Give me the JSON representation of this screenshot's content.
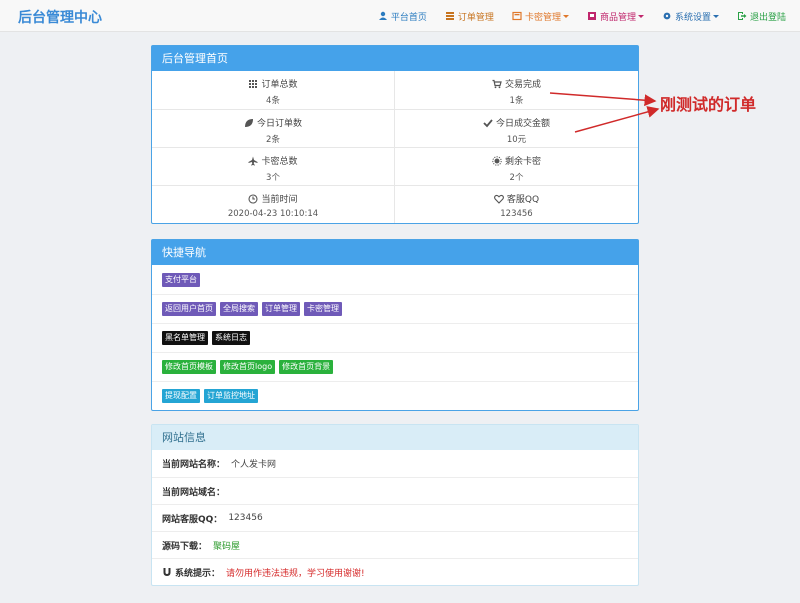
{
  "header": {
    "title": "后台管理中心",
    "nav": [
      {
        "label": "平台首页",
        "icon": "user-icon",
        "color": "#2a7bbf",
        "caret": false
      },
      {
        "label": "订单管理",
        "icon": "list-icon",
        "color": "#c7741f",
        "caret": false
      },
      {
        "label": "卡密管理",
        "icon": "card-icon",
        "color": "#e0782b",
        "caret": true
      },
      {
        "label": "商品管理",
        "icon": "shop-icon",
        "color": "#c0266c",
        "caret": true
      },
      {
        "label": "系统设置",
        "icon": "gear-icon",
        "color": "#2a6fb0",
        "caret": true
      },
      {
        "label": "退出登陆",
        "icon": "exit-icon",
        "color": "#29a045",
        "caret": false
      }
    ]
  },
  "home_panel": {
    "title": "后台管理首页",
    "stats": [
      {
        "label": "订单总数",
        "icon": "grid-icon",
        "value": "4条"
      },
      {
        "label": "交易完成",
        "icon": "cart-icon",
        "value": "1条"
      },
      {
        "label": "今日订单数",
        "icon": "leaf-icon",
        "value": "2条"
      },
      {
        "label": "今日成交金额",
        "icon": "check-icon",
        "value": "10元"
      },
      {
        "label": "卡密总数",
        "icon": "plane-icon",
        "value": "3个"
      },
      {
        "label": "剩余卡密",
        "icon": "sun-icon",
        "value": "2个"
      },
      {
        "label": "当前时间",
        "icon": "clock-icon",
        "value": "2020-04-23 10:10:14"
      },
      {
        "label": "客服QQ",
        "icon": "heart-icon",
        "value": "123456"
      }
    ]
  },
  "quick_nav": {
    "title": "快捷导航",
    "rows": [
      [
        {
          "label": "支付平台",
          "color": "purple"
        }
      ],
      [
        {
          "label": "返回用户首页",
          "color": "purple"
        },
        {
          "label": "全局搜索",
          "color": "purple"
        },
        {
          "label": "订单管理",
          "color": "purple"
        },
        {
          "label": "卡密管理",
          "color": "purple"
        }
      ],
      [
        {
          "label": "黑名单管理",
          "color": "black"
        },
        {
          "label": "系统日志",
          "color": "black"
        }
      ],
      [
        {
          "label": "修改首页模板",
          "color": "green"
        },
        {
          "label": "修改首页logo",
          "color": "green"
        },
        {
          "label": "修改首页背景",
          "color": "green"
        }
      ],
      [
        {
          "label": "提现配置",
          "color": "blue"
        },
        {
          "label": "订单监控地址",
          "color": "blue"
        }
      ]
    ]
  },
  "site_info": {
    "title": "网站信息",
    "rows": [
      {
        "label": "当前网站名称：",
        "value": "个人发卡网",
        "style": ""
      },
      {
        "label": "当前网站域名：",
        "value": "",
        "style": ""
      },
      {
        "label": "网站客服QQ：",
        "value": "123456",
        "style": ""
      },
      {
        "label": "源码下载：",
        "value": "聚码屋",
        "style": "green"
      },
      {
        "label": "系统提示：",
        "value": "请勿用作违法违规，学习使用谢谢!",
        "style": "red",
        "icon": "magnet-icon"
      }
    ]
  },
  "annotation": {
    "text": "刚测试的订单",
    "color": "#d02a2a"
  }
}
